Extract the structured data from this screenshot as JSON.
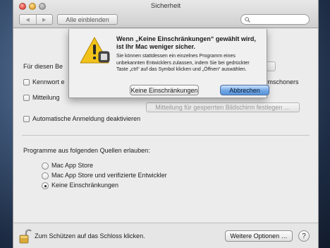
{
  "window": {
    "title": "Sicherheit"
  },
  "toolbar": {
    "back_glyph": "◀",
    "forward_glyph": "▶",
    "show_all_label": "Alle einblenden",
    "search_placeholder": ""
  },
  "background": {
    "row1_label": "Für diesen Be",
    "row2_label": "Kennwort e",
    "row2_right_label": "ichirmschoners",
    "row3_label": "Mitteilung",
    "lockscreen_button_label": "Mitteilung für gesperrten Bildschirm festlegen …",
    "auto_login_label": "Automatische Anmeldung deaktivieren",
    "sources_label": "Programme aus folgenden Quellen erlauben:",
    "options": [
      {
        "label": "Mac App Store",
        "selected": false
      },
      {
        "label": "Mac App Store und verifizierte Entwickler",
        "selected": false
      },
      {
        "label": "Keine Einschränkungen",
        "selected": true
      }
    ]
  },
  "bottom": {
    "lock_text": "Zum Schützen auf das Schloss klicken.",
    "more_options_label": "Weitere Optionen …",
    "help_label": "?"
  },
  "alert": {
    "icon": "warning-icon",
    "title": "Wenn „Keine Einschränkungen“ gewählt wird, ist Ihr Mac weniger sicher.",
    "body": "Sie können stattdessen ein einzelnes Programm eines unbekannten Entwicklers zulassen, indem Sie bei gedrückter Taste „ctrl“ auf das Symbol klicken und „Öffnen“ auswählen.",
    "confirm_label": "Keine Einschränkungen",
    "cancel_label": "Abbrechen"
  },
  "colors": {
    "accent": "#5a95da",
    "window_bg": "#ececec",
    "warning": "#f2c21a"
  }
}
